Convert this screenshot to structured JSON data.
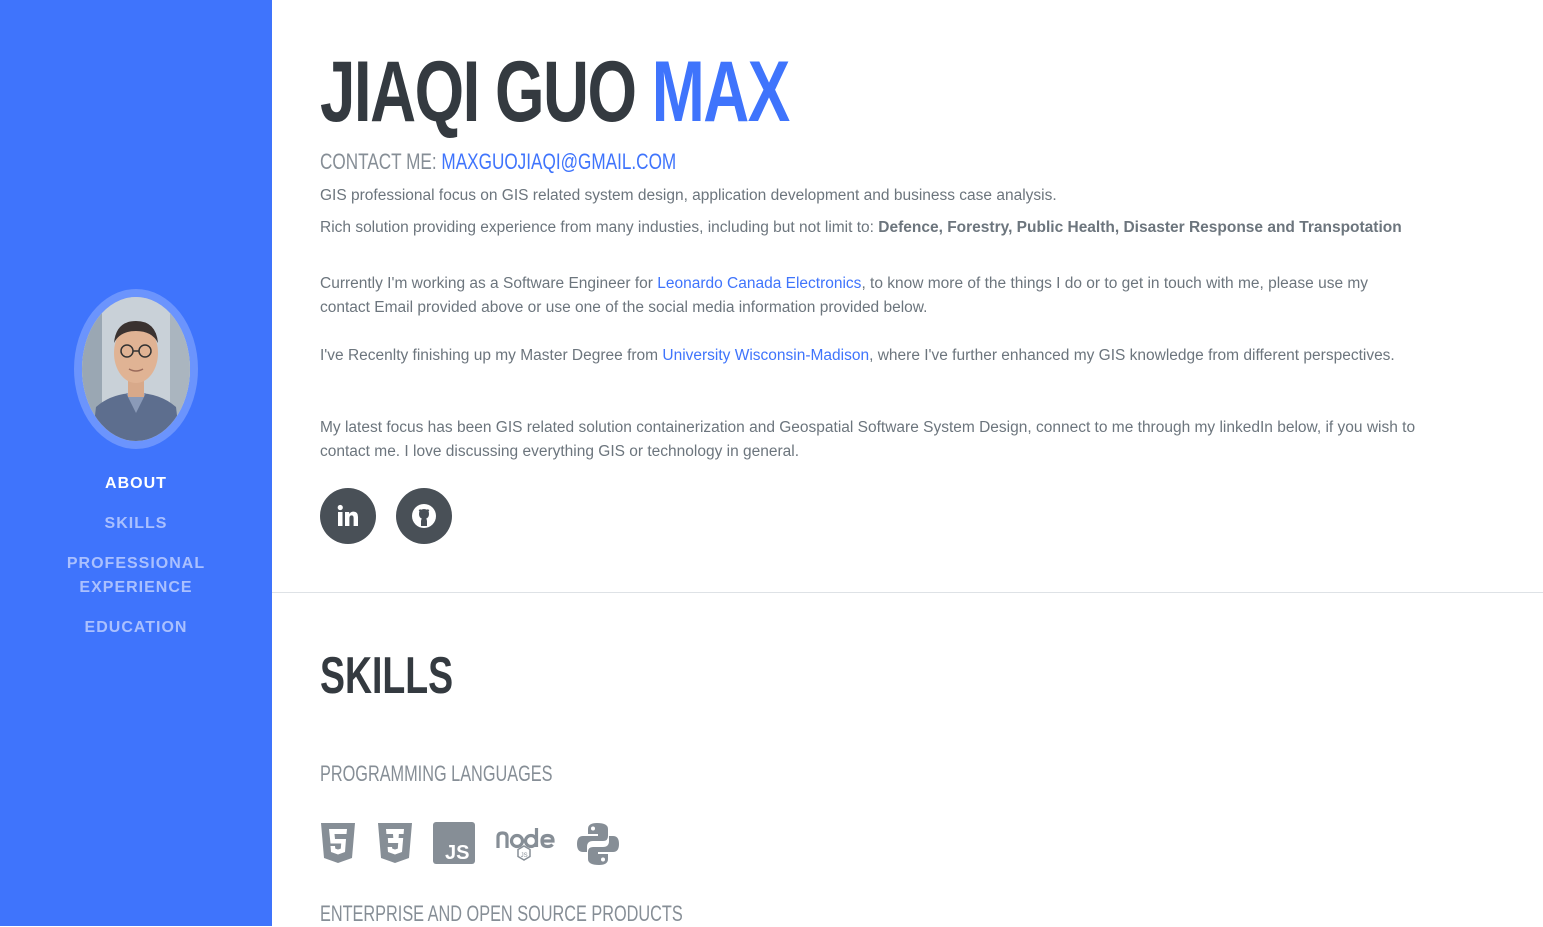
{
  "sidebar": {
    "nav": [
      {
        "label": "About",
        "active": true
      },
      {
        "label": "Skills"
      },
      {
        "label": "Professional Experience"
      },
      {
        "label": "Education"
      }
    ]
  },
  "about": {
    "first_name": "JIAQI GUO",
    "last_name": "MAX",
    "contact_label": "CONTACT ME:",
    "email": "MAXGUOJIAQI@GMAIL.COM",
    "p1": "GIS professional focus on GIS related system design, application development and business case analysis.",
    "p2_prefix": "Rich solution providing experience from many industies, including but not limit to: ",
    "p2_bold": "Defence, Forestry, Public Health, Disaster Response and Transpotation",
    "p3_prefix": "Currently I'm working as a Software Engineer for ",
    "p3_link": "Leonardo Canada Electronics",
    "p3_suffix": ", to know more of the things I do or to get in touch with me, please use my contact Email provided above or use one of the social media information provided below.",
    "p4_prefix": "I've Recenlty finishing up my Master Degree from ",
    "p4_link": "University Wisconsin-Madison",
    "p4_suffix": ", where I've further enhanced my GIS knowledge from different perspectives.",
    "p5": "My latest focus has been GIS related solution containerization and Geospatial Software System Design, connect to me through my linkedIn below, if you wish to contact me. I love discussing everything GIS or technology in general.",
    "social": [
      {
        "icon": "linkedin-icon"
      },
      {
        "icon": "github-icon"
      }
    ]
  },
  "skills": {
    "title": "SKILLS",
    "programming_heading": "Programming Languages",
    "programming_icons": [
      "html5-icon",
      "css3-icon",
      "js-icon",
      "nodejs-icon",
      "python-icon"
    ],
    "enterprise_heading": "Enterprise and Open Source Products"
  },
  "colors": {
    "accent": "#3f74fc",
    "dark": "#343a40",
    "muted": "#6c757d",
    "icon": "#868e96"
  }
}
